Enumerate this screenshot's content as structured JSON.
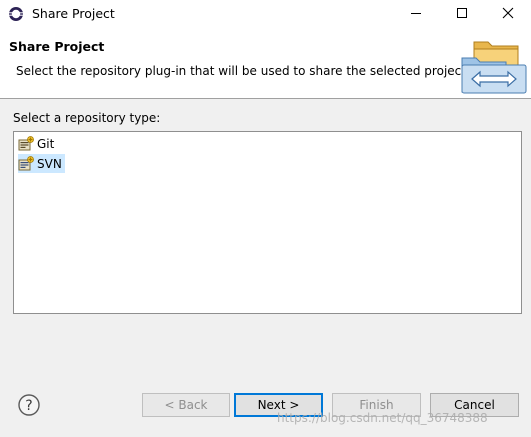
{
  "window": {
    "title": "Share Project",
    "icon": "eclipse-icon",
    "controls": [
      "minimize-icon",
      "maximize-icon",
      "close-icon"
    ]
  },
  "banner": {
    "title": "Share Project",
    "description": "Select the repository plug-in that will be used to share the selected project.",
    "image": "share-folders-icon"
  },
  "repository_list": {
    "label": "Select a repository type:",
    "items": [
      {
        "label": "Git",
        "icon": "git-repository-icon",
        "selected": false
      },
      {
        "label": "SVN",
        "icon": "svn-repository-icon",
        "selected": true
      }
    ]
  },
  "buttons": {
    "help_icon": "help-icon",
    "back": "< Back",
    "next": "Next >",
    "finish": "Finish",
    "cancel": "Cancel"
  },
  "watermark": "https://blog.csdn.net/qq_36748388",
  "colors": {
    "selection": "#cce8ff",
    "default_button_border": "#0078d7",
    "banner_background": "#ffffff",
    "dialog_background": "#f0f0f0"
  }
}
